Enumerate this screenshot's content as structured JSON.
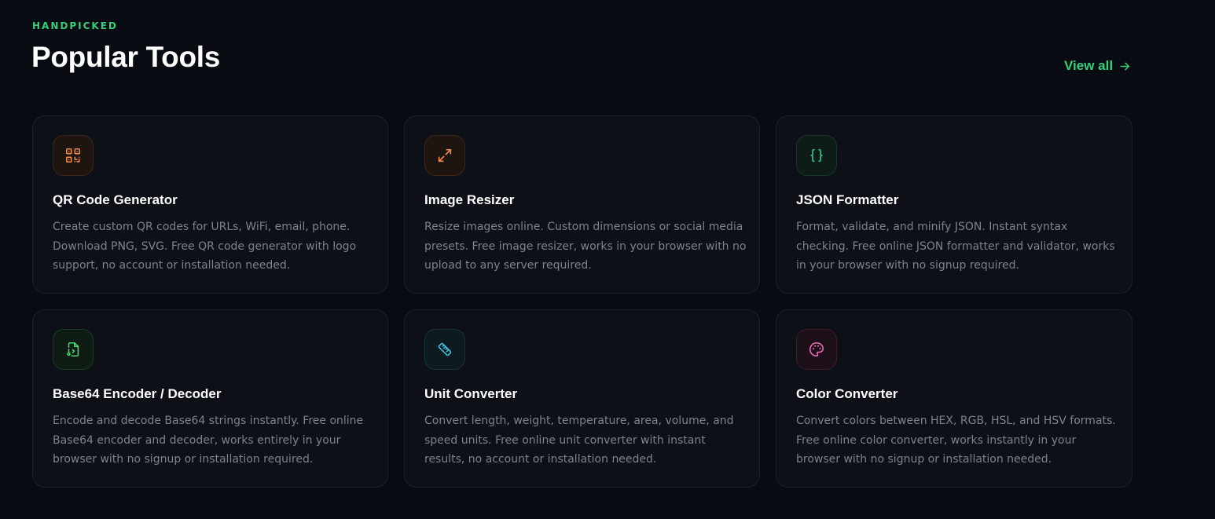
{
  "header": {
    "eyebrow": "HANDPICKED",
    "title": "Popular Tools",
    "view_all_label": "View all",
    "view_all_icon": "arrow-right-icon"
  },
  "colors": {
    "accent": "#34d07a",
    "background": "#080b11",
    "card": "#0d1117",
    "muted_text": "#7b8290"
  },
  "tools": [
    {
      "title": "QR Code Generator",
      "description": "Create custom QR codes for URLs, WiFi, email, phone. Download PNG, SVG. Free QR code generator with logo support, no account or installation needed.",
      "icon": "qr-code-icon",
      "icon_color": "#f0884a"
    },
    {
      "title": "Image Resizer",
      "description": "Resize images online. Custom dimensions or social media presets. Free image resizer, works in your browser with no upload to any server required.",
      "icon": "expand-arrows-icon",
      "icon_color": "#f0884a"
    },
    {
      "title": "JSON Formatter",
      "description": "Format, validate, and minify JSON. Instant syntax checking. Free online JSON formatter and validator, works in your browser with no signup required.",
      "icon": "curly-braces-icon",
      "icon_color": "#2fcf8e"
    },
    {
      "title": "Base64 Encoder / Decoder",
      "description": "Encode and decode Base64 strings instantly. Free online Base64 encoder and decoder, works entirely in your browser with no signup or installation required.",
      "icon": "file-code-icon",
      "icon_color": "#4cd670"
    },
    {
      "title": "Unit Converter",
      "description": "Convert length, weight, temperature, area, volume, and speed units. Free online unit converter with instant results, no account or installation needed.",
      "icon": "ruler-icon",
      "icon_color": "#3cc7e0"
    },
    {
      "title": "Color Converter",
      "description": "Convert colors between HEX, RGB, HSL, and HSV formats. Free online color converter, works instantly in your browser with no signup or installation needed.",
      "icon": "palette-icon",
      "icon_color": "#f06fb8"
    }
  ]
}
